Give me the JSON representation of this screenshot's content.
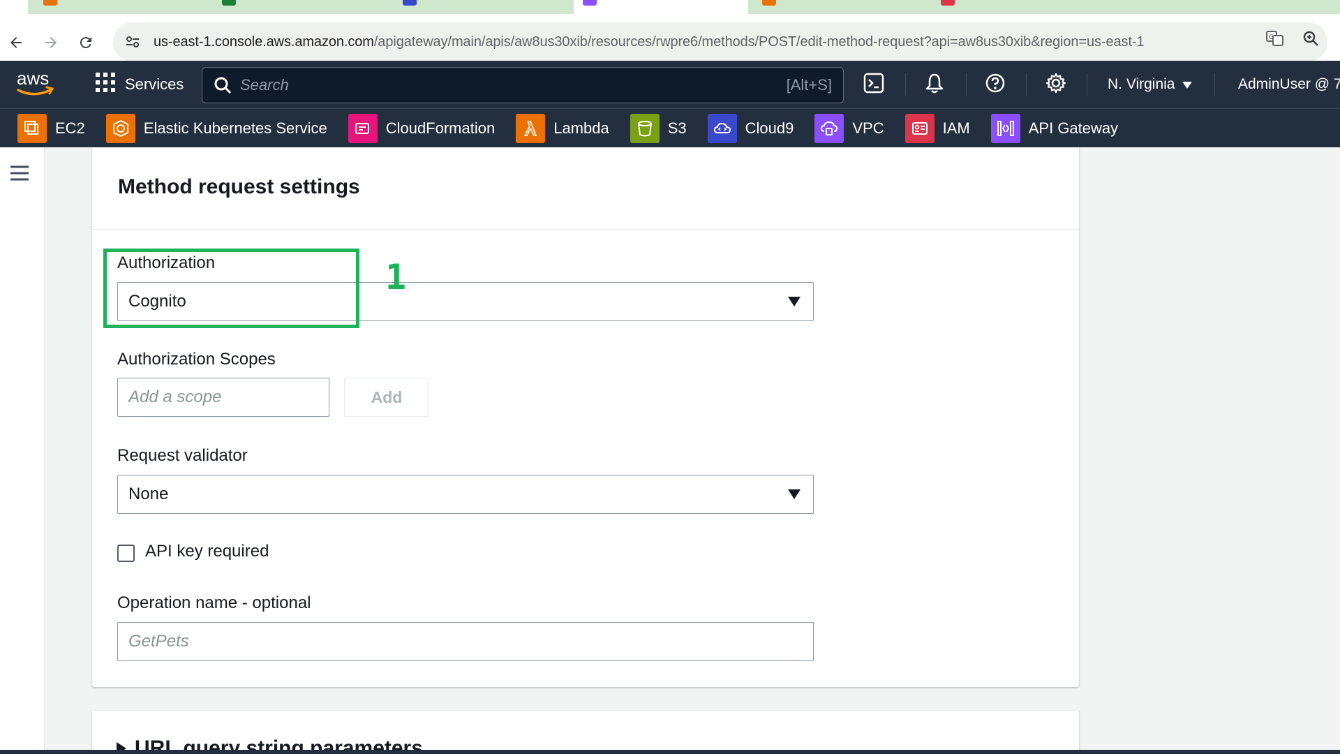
{
  "browser": {
    "url_host": "us-east-1.console.aws.amazon.com",
    "url_path": "/apigateway/main/apis/aw8us30xib/resources/rwpre6/methods/POST/edit-method-request?api=aw8us30xib&region=us-east-1"
  },
  "topnav": {
    "services_label": "Services",
    "search_placeholder": "Search",
    "search_shortcut": "[Alt+S]",
    "region_label": "N. Virginia",
    "user_label": "AdminUser @ 7"
  },
  "favorites": [
    {
      "label": "EC2",
      "color": "#ed7100"
    },
    {
      "label": "Elastic Kubernetes Service",
      "color": "#ed7100"
    },
    {
      "label": "CloudFormation",
      "color": "#e7157b"
    },
    {
      "label": "Lambda",
      "color": "#ed7100"
    },
    {
      "label": "S3",
      "color": "#7aa116"
    },
    {
      "label": "Cloud9",
      "color": "#3b48cc"
    },
    {
      "label": "VPC",
      "color": "#8c4fff"
    },
    {
      "label": "IAM",
      "color": "#dd344c"
    },
    {
      "label": "API Gateway",
      "color": "#8c4fff"
    }
  ],
  "settings": {
    "title": "Method request settings",
    "authorization_label": "Authorization",
    "authorization_value": "Cognito",
    "scopes_label": "Authorization Scopes",
    "scope_placeholder": "Add a scope",
    "add_button": "Add",
    "validator_label": "Request validator",
    "validator_value": "None",
    "api_key_label": "API key required",
    "api_key_checked": false,
    "operation_label": "Operation name - optional",
    "operation_placeholder": "GetPets"
  },
  "annotation": {
    "number": "1",
    "color": "#1cb35a"
  },
  "next_section": {
    "title": "URL query string parameters"
  }
}
